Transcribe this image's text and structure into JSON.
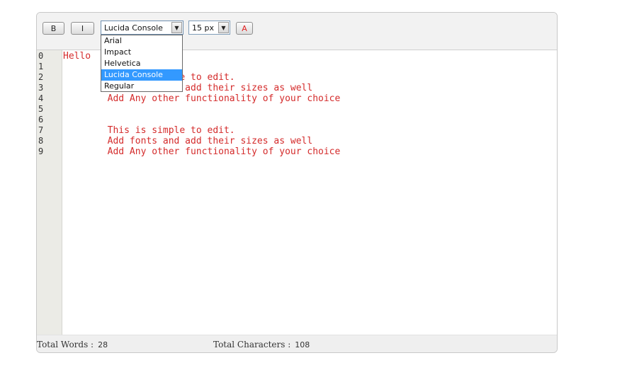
{
  "toolbar": {
    "bold_label": "B",
    "italic_label": "I",
    "font_select_value": "Lucida Console",
    "size_select_value": "15 px",
    "color_label": "A"
  },
  "font_dropdown": {
    "options": [
      "Arial",
      "Impact",
      "Helvetica",
      "Lucida Console",
      "Regular"
    ],
    "selected": "Lucida Console"
  },
  "editor": {
    "line_numbers": [
      "0",
      "1",
      "2",
      "3",
      "4",
      "5",
      "6",
      "7",
      "8",
      "9"
    ],
    "lines": [
      "Hello",
      "",
      "        This is simple to edit.",
      "        Add fonts and add their sizes as well",
      "        Add Any other functionality of your choice",
      "",
      "",
      "        This is simple to edit.",
      "        Add fonts and add their sizes as well",
      "        Add Any other functionality of your choice"
    ],
    "text_color": "#d42b2b"
  },
  "status": {
    "words_label": "Total Words :",
    "words_value": "28",
    "chars_label": "Total Characters :",
    "chars_value": "108"
  }
}
